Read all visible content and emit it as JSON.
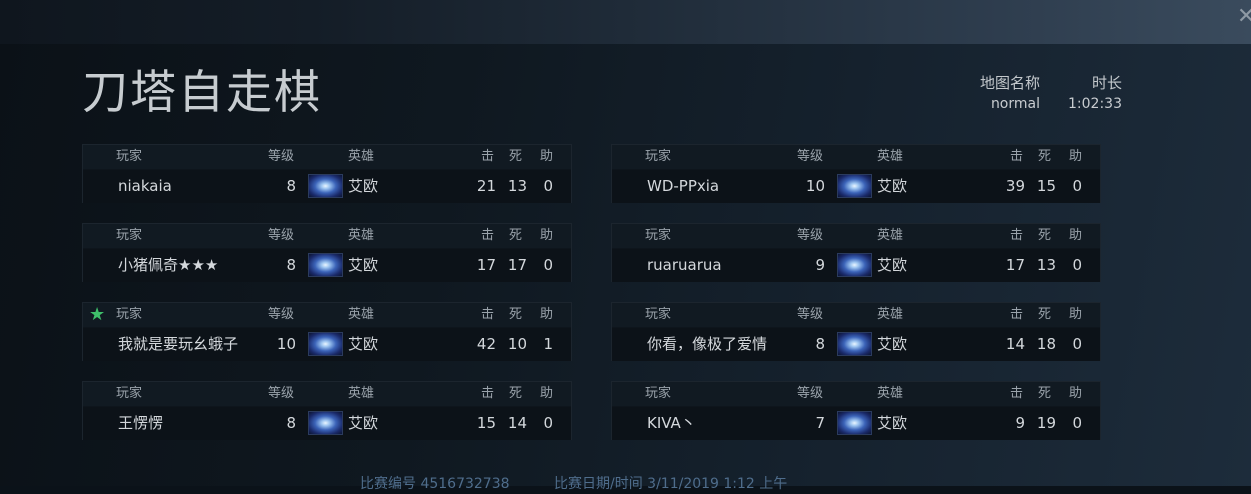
{
  "game_title": "刀塔自走棋",
  "meta": {
    "map_label": "地图名称",
    "map_value": "normal",
    "duration_label": "时长",
    "duration_value": "1:02:33"
  },
  "headers": {
    "player": "玩家",
    "level": "等级",
    "hero": "英雄",
    "kills": "击",
    "deaths": "死",
    "assists": "助"
  },
  "players": [
    {
      "name": "niakaia",
      "level": "8",
      "hero": "艾欧",
      "kills": "21",
      "deaths": "13",
      "assists": "0"
    },
    {
      "name": "WD-PPxia",
      "level": "10",
      "hero": "艾欧",
      "kills": "39",
      "deaths": "15",
      "assists": "0"
    },
    {
      "name": "小猪佩奇★★★",
      "level": "8",
      "hero": "艾欧",
      "kills": "17",
      "deaths": "17",
      "assists": "0"
    },
    {
      "name": "ruaruarua",
      "level": "9",
      "hero": "艾欧",
      "kills": "17",
      "deaths": "13",
      "assists": "0"
    },
    {
      "name": "我就是要玩幺蛾子",
      "level": "10",
      "hero": "艾欧",
      "kills": "42",
      "deaths": "10",
      "assists": "1",
      "starred": true
    },
    {
      "name": "你看，像极了爱情",
      "level": "8",
      "hero": "艾欧",
      "kills": "14",
      "deaths": "18",
      "assists": "0"
    },
    {
      "name": "王愣愣",
      "level": "8",
      "hero": "艾欧",
      "kills": "15",
      "deaths": "14",
      "assists": "0"
    },
    {
      "name": "KIVA丶",
      "level": "7",
      "hero": "艾欧",
      "kills": "9",
      "deaths": "19",
      "assists": "0"
    }
  ],
  "star_glyph": "★",
  "close_glyph": "✕",
  "footer": {
    "match_id": "比赛编号 4516732738",
    "match_date": "比赛日期/时间 3/11/2019 1:12 上午"
  },
  "icons": {
    "close": "close-icon",
    "star": "star-icon",
    "hero": "hero-portrait-icon"
  }
}
